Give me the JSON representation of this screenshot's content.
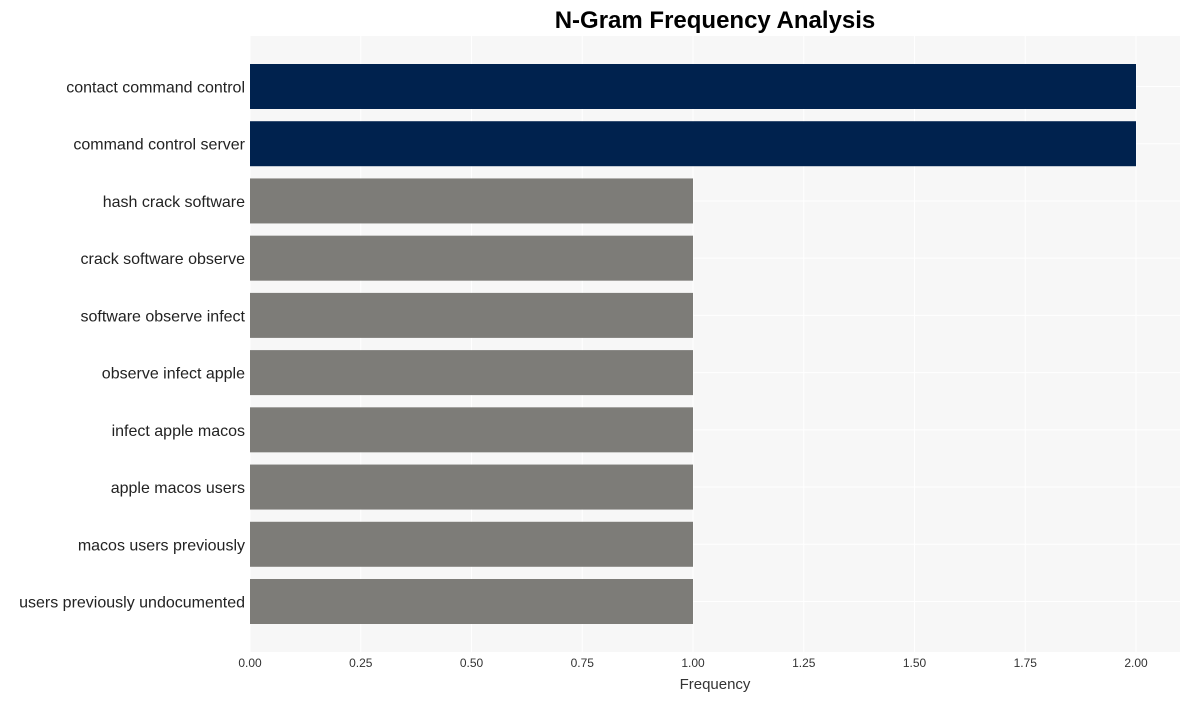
{
  "chart_data": {
    "type": "bar",
    "orientation": "horizontal",
    "title": "N-Gram Frequency Analysis",
    "xlabel": "Frequency",
    "ylabel": "",
    "xlim": [
      0,
      2.1
    ],
    "xticks": [
      0,
      0.25,
      0.5,
      0.75,
      1.0,
      1.25,
      1.5,
      1.75,
      2.0
    ],
    "xtick_labels": [
      "0.00",
      "0.25",
      "0.50",
      "0.75",
      "1.00",
      "1.25",
      "1.50",
      "1.75",
      "2.00"
    ],
    "grid": true,
    "categories": [
      "contact command control",
      "command control server",
      "hash crack software",
      "crack software observe",
      "software observe infect",
      "observe infect apple",
      "infect apple macos",
      "apple macos users",
      "macos users previously",
      "users previously undocumented"
    ],
    "values": [
      2,
      2,
      1,
      1,
      1,
      1,
      1,
      1,
      1,
      1
    ],
    "colors": {
      "highlight": "#00224e",
      "default": "#7d7c78",
      "plot_background": "#f7f7f7",
      "grid": "#ffffff"
    }
  }
}
